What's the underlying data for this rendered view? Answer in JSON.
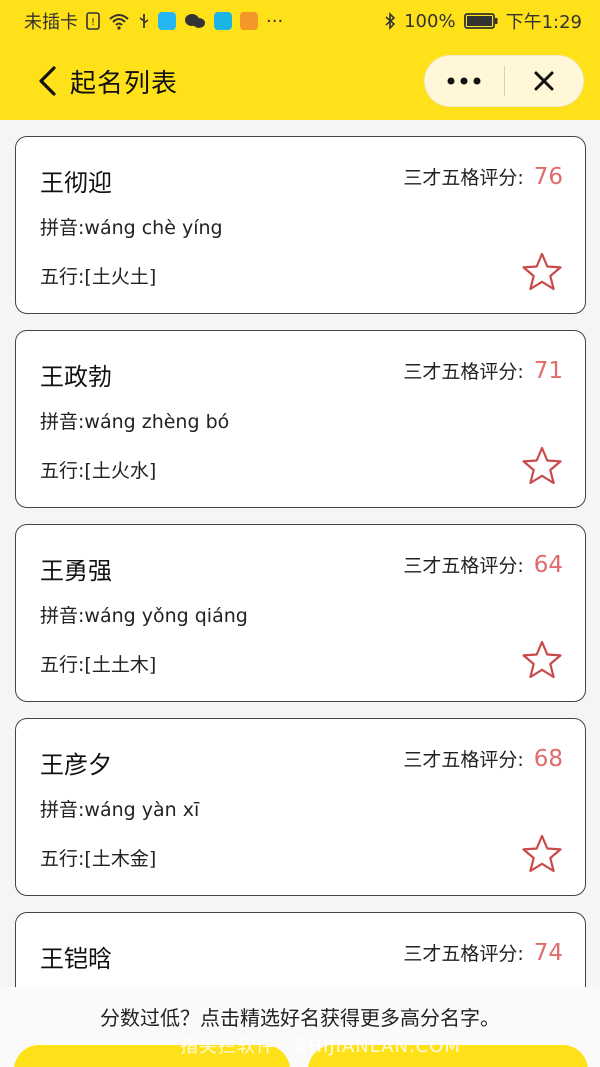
{
  "status_bar": {
    "carrier": "未插卡",
    "battery": "100%",
    "time": "下午1:29",
    "more": "···"
  },
  "header": {
    "title": "起名列表",
    "more_label": "•••",
    "close_label": "✕"
  },
  "score_label": "三才五格评分:",
  "names": [
    {
      "name": "王彻迎",
      "score": "76",
      "pinyin": "拼音:wáng chè yíng",
      "wuxing": "五行:[土火土]"
    },
    {
      "name": "王政勃",
      "score": "71",
      "pinyin": "拼音:wáng zhèng bó",
      "wuxing": "五行:[土火水]"
    },
    {
      "name": "王勇强",
      "score": "64",
      "pinyin": "拼音:wáng yǒng qiáng",
      "wuxing": "五行:[土土木]"
    },
    {
      "name": "王彦夕",
      "score": "68",
      "pinyin": "拼音:wáng yàn xī",
      "wuxing": "五行:[土木金]"
    },
    {
      "name": "王铠晗",
      "score": "74"
    }
  ],
  "bottom": {
    "tip": "分数过低？点击精选好名获得更多高分名字。",
    "watermark": "指尖拦软件 · ZHIJIANLAN.COM"
  },
  "colors": {
    "header_bg": "#ffe11a",
    "score": "#e06b6b",
    "star": "#c94a4a"
  }
}
